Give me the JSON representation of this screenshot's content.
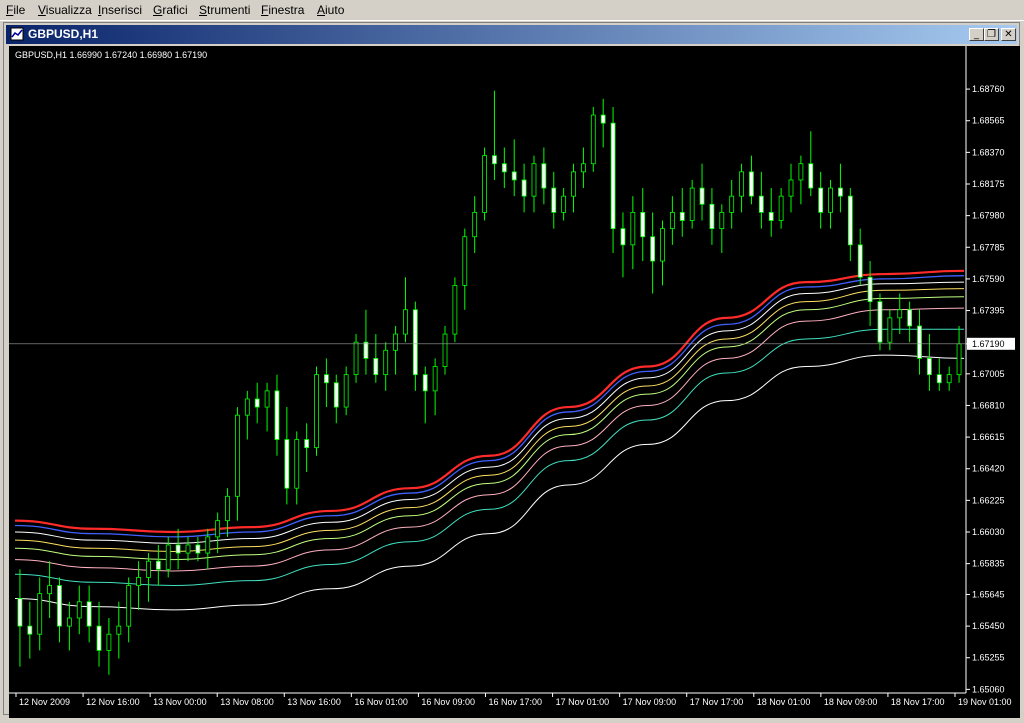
{
  "menu": [
    "File",
    "Visualizza",
    "Inserisci",
    "Grafici",
    "Strumenti",
    "Finestra",
    "Aiuto"
  ],
  "window": {
    "title": "GBPUSD,H1",
    "minimize": "_",
    "restore": "❐",
    "close": "✕"
  },
  "chart_info": "GBPUSD,H1  1.66990 1.67240 1.66980 1.67190",
  "colors": {
    "background": "#000000",
    "candle_up": "#000000",
    "candle_down": "#ffffff",
    "candle_outline": "#00ff00",
    "grid_text": "#ffffff",
    "current_price_bg": "#ffffff"
  },
  "chart_data": {
    "type": "candlestick",
    "ylim": [
      1.6505,
      1.6889
    ],
    "price_ticks": [
      "1.68760",
      "1.68565",
      "1.68370",
      "1.68175",
      "1.67980",
      "1.67785",
      "1.67590",
      "1.67395",
      "1.67190",
      "1.67005",
      "1.66810",
      "1.66615",
      "1.66420",
      "1.66225",
      "1.66030",
      "1.65835",
      "1.65645",
      "1.65450",
      "1.65255",
      "1.65060"
    ],
    "current_price": "1.67190",
    "time_labels": [
      "12 Nov 2009",
      "12 Nov 16:00",
      "13 Nov 00:00",
      "13 Nov 08:00",
      "13 Nov 16:00",
      "16 Nov 01:00",
      "16 Nov 09:00",
      "16 Nov 17:00",
      "17 Nov 01:00",
      "17 Nov 09:00",
      "17 Nov 17:00",
      "18 Nov 01:00",
      "18 Nov 09:00",
      "18 Nov 17:00",
      "19 Nov 01:00"
    ],
    "candles": [
      [
        1.6562,
        1.658,
        1.652,
        1.6545
      ],
      [
        1.6545,
        1.656,
        1.6525,
        1.654
      ],
      [
        1.654,
        1.6575,
        1.653,
        1.6565
      ],
      [
        1.6565,
        1.6585,
        1.655,
        1.657
      ],
      [
        1.657,
        1.6575,
        1.6535,
        1.6545
      ],
      [
        1.6545,
        1.656,
        1.653,
        1.655
      ],
      [
        1.655,
        1.657,
        1.654,
        1.656
      ],
      [
        1.656,
        1.657,
        1.6535,
        1.6545
      ],
      [
        1.6545,
        1.656,
        1.652,
        1.653
      ],
      [
        1.653,
        1.655,
        1.6515,
        1.654
      ],
      [
        1.654,
        1.656,
        1.6525,
        1.6545
      ],
      [
        1.6545,
        1.6575,
        1.6535,
        1.657
      ],
      [
        1.657,
        1.6585,
        1.6555,
        1.6575
      ],
      [
        1.6575,
        1.659,
        1.656,
        1.6585
      ],
      [
        1.6585,
        1.6595,
        1.657,
        1.658
      ],
      [
        1.658,
        1.66,
        1.6575,
        1.6595
      ],
      [
        1.6595,
        1.6605,
        1.658,
        1.659
      ],
      [
        1.659,
        1.66,
        1.6585,
        1.6595
      ],
      [
        1.6595,
        1.66,
        1.6585,
        1.659
      ],
      [
        1.659,
        1.6605,
        1.658,
        1.66
      ],
      [
        1.66,
        1.6615,
        1.659,
        1.661
      ],
      [
        1.661,
        1.663,
        1.66,
        1.6625
      ],
      [
        1.6625,
        1.668,
        1.661,
        1.6675
      ],
      [
        1.6675,
        1.669,
        1.666,
        1.6685
      ],
      [
        1.6685,
        1.6695,
        1.667,
        1.668
      ],
      [
        1.668,
        1.6695,
        1.6665,
        1.669
      ],
      [
        1.669,
        1.67,
        1.665,
        1.666
      ],
      [
        1.666,
        1.668,
        1.662,
        1.663
      ],
      [
        1.663,
        1.6665,
        1.662,
        1.666
      ],
      [
        1.666,
        1.667,
        1.664,
        1.6655
      ],
      [
        1.6655,
        1.6705,
        1.665,
        1.67
      ],
      [
        1.67,
        1.671,
        1.668,
        1.6695
      ],
      [
        1.6695,
        1.67,
        1.667,
        1.668
      ],
      [
        1.668,
        1.6705,
        1.6675,
        1.67
      ],
      [
        1.67,
        1.6725,
        1.6695,
        1.672
      ],
      [
        1.672,
        1.674,
        1.67,
        1.671
      ],
      [
        1.671,
        1.6725,
        1.6695,
        1.67
      ],
      [
        1.67,
        1.672,
        1.669,
        1.6715
      ],
      [
        1.6715,
        1.673,
        1.67,
        1.6725
      ],
      [
        1.6725,
        1.676,
        1.672,
        1.674
      ],
      [
        1.674,
        1.6745,
        1.669,
        1.67
      ],
      [
        1.67,
        1.6705,
        1.667,
        1.669
      ],
      [
        1.669,
        1.671,
        1.6675,
        1.6705
      ],
      [
        1.6705,
        1.673,
        1.67,
        1.6725
      ],
      [
        1.6725,
        1.676,
        1.672,
        1.6755
      ],
      [
        1.6755,
        1.679,
        1.674,
        1.6785
      ],
      [
        1.6785,
        1.681,
        1.6775,
        1.68
      ],
      [
        1.68,
        1.684,
        1.6795,
        1.6835
      ],
      [
        1.6835,
        1.6875,
        1.682,
        1.683
      ],
      [
        1.683,
        1.684,
        1.6815,
        1.6825
      ],
      [
        1.6825,
        1.6845,
        1.681,
        1.682
      ],
      [
        1.682,
        1.683,
        1.68,
        1.681
      ],
      [
        1.681,
        1.6835,
        1.68,
        1.683
      ],
      [
        1.683,
        1.684,
        1.6805,
        1.6815
      ],
      [
        1.6815,
        1.6825,
        1.679,
        1.68
      ],
      [
        1.68,
        1.6815,
        1.6795,
        1.681
      ],
      [
        1.681,
        1.683,
        1.68,
        1.6825
      ],
      [
        1.6825,
        1.684,
        1.6815,
        1.683
      ],
      [
        1.683,
        1.6865,
        1.6825,
        1.686
      ],
      [
        1.686,
        1.687,
        1.684,
        1.6855
      ],
      [
        1.6855,
        1.6865,
        1.6775,
        1.679
      ],
      [
        1.679,
        1.68,
        1.676,
        1.678
      ],
      [
        1.678,
        1.681,
        1.6765,
        1.68
      ],
      [
        1.68,
        1.6815,
        1.677,
        1.6785
      ],
      [
        1.6785,
        1.68,
        1.675,
        1.677
      ],
      [
        1.677,
        1.6795,
        1.6755,
        1.679
      ],
      [
        1.679,
        1.681,
        1.678,
        1.68
      ],
      [
        1.68,
        1.6815,
        1.6785,
        1.6795
      ],
      [
        1.6795,
        1.682,
        1.679,
        1.6815
      ],
      [
        1.6815,
        1.683,
        1.6795,
        1.6805
      ],
      [
        1.6805,
        1.6815,
        1.678,
        1.679
      ],
      [
        1.679,
        1.6805,
        1.6775,
        1.68
      ],
      [
        1.68,
        1.682,
        1.679,
        1.681
      ],
      [
        1.681,
        1.683,
        1.68,
        1.6825
      ],
      [
        1.6825,
        1.6835,
        1.6805,
        1.681
      ],
      [
        1.681,
        1.6825,
        1.679,
        1.68
      ],
      [
        1.68,
        1.6815,
        1.6785,
        1.6795
      ],
      [
        1.6795,
        1.6815,
        1.679,
        1.681
      ],
      [
        1.681,
        1.683,
        1.68,
        1.682
      ],
      [
        1.682,
        1.6835,
        1.6805,
        1.683
      ],
      [
        1.683,
        1.685,
        1.681,
        1.6815
      ],
      [
        1.6815,
        1.6825,
        1.679,
        1.68
      ],
      [
        1.68,
        1.682,
        1.679,
        1.6815
      ],
      [
        1.6815,
        1.683,
        1.68,
        1.681
      ],
      [
        1.681,
        1.6815,
        1.677,
        1.678
      ],
      [
        1.678,
        1.679,
        1.6755,
        1.676
      ],
      [
        1.676,
        1.677,
        1.673,
        1.6745
      ],
      [
        1.6745,
        1.675,
        1.6715,
        1.672
      ],
      [
        1.672,
        1.674,
        1.6715,
        1.6735
      ],
      [
        1.6735,
        1.675,
        1.6725,
        1.674
      ],
      [
        1.674,
        1.6745,
        1.672,
        1.673
      ],
      [
        1.673,
        1.674,
        1.67,
        1.671
      ],
      [
        1.671,
        1.6725,
        1.669,
        1.67
      ],
      [
        1.67,
        1.671,
        1.669,
        1.6695
      ],
      [
        1.6695,
        1.6705,
        1.669,
        1.67
      ],
      [
        1.67,
        1.673,
        1.6695,
        1.6719
      ]
    ],
    "moving_averages": [
      {
        "color": "#ff2a2a",
        "width": 2.2,
        "values": [
          1.661,
          1.6605,
          1.6603,
          1.6606,
          1.6616,
          1.663,
          1.665,
          1.668,
          1.6705,
          1.6735,
          1.6757,
          1.6762,
          1.6764
        ]
      },
      {
        "color": "#4060ff",
        "width": 1.3,
        "values": [
          1.6607,
          1.6602,
          1.66,
          1.6603,
          1.6613,
          1.6627,
          1.6647,
          1.6677,
          1.6702,
          1.6731,
          1.6754,
          1.6759,
          1.6761
        ]
      },
      {
        "color": "#ffffff",
        "width": 1,
        "values": [
          1.6603,
          1.6598,
          1.6596,
          1.6599,
          1.6609,
          1.6623,
          1.6643,
          1.6673,
          1.6698,
          1.6727,
          1.675,
          1.6756,
          1.6757
        ]
      },
      {
        "color": "#ffe060",
        "width": 1,
        "values": [
          1.6598,
          1.6593,
          1.6591,
          1.6594,
          1.6604,
          1.6618,
          1.6638,
          1.6668,
          1.6693,
          1.6722,
          1.6745,
          1.6752,
          1.6753
        ]
      },
      {
        "color": "#c0ff80",
        "width": 1,
        "values": [
          1.6593,
          1.6588,
          1.6586,
          1.6589,
          1.6599,
          1.6613,
          1.6633,
          1.6663,
          1.6688,
          1.6717,
          1.674,
          1.6747,
          1.6748
        ]
      },
      {
        "color": "#ffb0c0",
        "width": 1,
        "values": [
          1.6586,
          1.6581,
          1.6579,
          1.6582,
          1.6592,
          1.6606,
          1.6626,
          1.6656,
          1.6681,
          1.671,
          1.6733,
          1.674,
          1.6741
        ]
      },
      {
        "color": "#40e0c0",
        "width": 1,
        "values": [
          1.6577,
          1.6572,
          1.657,
          1.6573,
          1.6583,
          1.6597,
          1.6617,
          1.6647,
          1.6672,
          1.6701,
          1.6722,
          1.6728,
          1.6728
        ]
      },
      {
        "color": "#ffffff",
        "width": 1,
        "values": [
          1.6562,
          1.6557,
          1.6555,
          1.6558,
          1.6568,
          1.6582,
          1.6602,
          1.6632,
          1.6657,
          1.6684,
          1.6705,
          1.6712,
          1.671
        ]
      }
    ]
  }
}
